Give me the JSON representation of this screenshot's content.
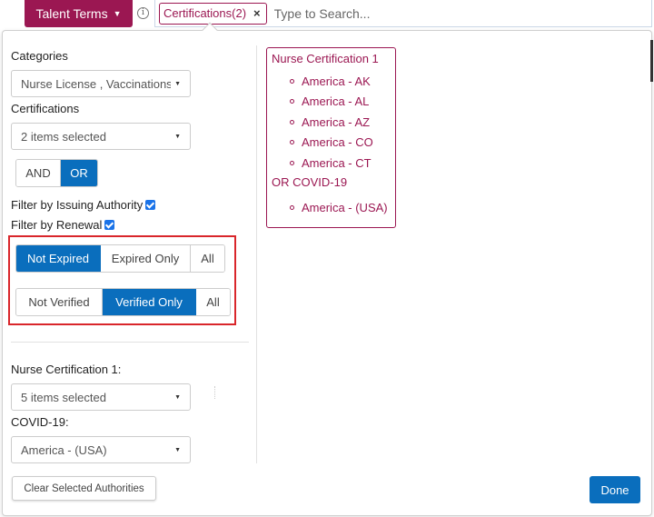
{
  "header": {
    "talent_terms_label": "Talent Terms",
    "info_icon": "info-icon",
    "chip_label": "Certifications(2)",
    "chip_close": "×",
    "search_placeholder": "Type to Search..."
  },
  "filters": {
    "categories_label": "Categories",
    "categories_value": "Nurse License , Vaccinations",
    "certifications_label": "Certifications",
    "certifications_value": "2 items selected",
    "logic_options": [
      "AND",
      "OR"
    ],
    "logic_selected": "OR",
    "issuing_authority_label": "Filter by Issuing Authority",
    "issuing_authority_checked": true,
    "renewal_label": "Filter by Renewal",
    "renewal_checked": true,
    "expiry_options": [
      "Not Expired",
      "Expired Only",
      "All"
    ],
    "expiry_selected": "Not Expired",
    "verification_options": [
      "Not Verified",
      "Verified Only",
      "All"
    ],
    "verification_selected": "Verified Only",
    "nurse_cert_label": "Nurse Certification 1:",
    "nurse_cert_value": "5 items selected",
    "covid_label": "COVID-19:",
    "covid_value": "America - (USA)"
  },
  "summary": {
    "heading": "Nurse Certification 1",
    "items": [
      "America - AK",
      "America - AL",
      "America - AZ",
      "America - CO",
      "America - CT"
    ],
    "second_heading": "OR COVID-19",
    "second_items": [
      "America - (USA)"
    ]
  },
  "footer": {
    "clear_label": "Clear Selected Authorities",
    "done_label": "Done"
  },
  "colors": {
    "brand": "#9b1752",
    "primary": "#0a6ebd",
    "highlight_box": "#d9262b"
  }
}
